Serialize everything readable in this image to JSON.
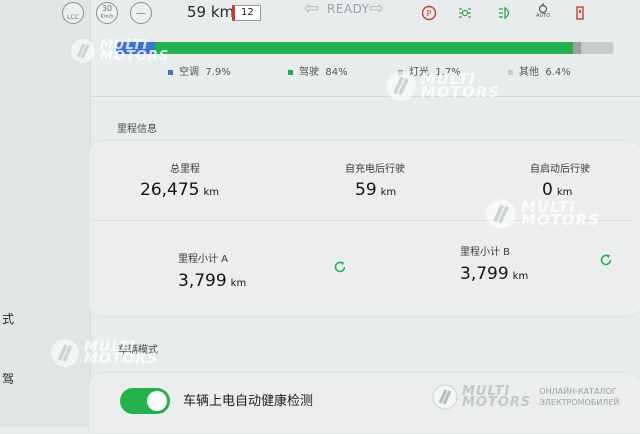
{
  "status_bar": {
    "lcc_label": "LCC",
    "speed_limit_label": "30",
    "speed_limit_unit": "Km/h",
    "minus_label": "—",
    "range_value": "59 km",
    "speed_limit_badge": "12",
    "gear_status": "READY",
    "indicator_colors": {
      "parking": "#d23a2a",
      "lights": "#2aa84a",
      "auto_light": "#2aa84a",
      "door": "#d23a2a"
    },
    "auto_label": "AUTO"
  },
  "energy": {
    "shares": [
      {
        "name": "空调",
        "value": "7.9%",
        "fraction": 0.079,
        "color": "#3a72d6"
      },
      {
        "name": "驾驶",
        "value": "84%",
        "fraction": 0.84,
        "color": "#22b24c"
      },
      {
        "name": "灯光",
        "value": "1.7%",
        "fraction": 0.017,
        "color": "#9a9fa2"
      },
      {
        "name": "其他",
        "value": "6.4%",
        "fraction": 0.064,
        "color": "#c8cbcc"
      }
    ]
  },
  "mileage": {
    "section_title": "里程信息",
    "total": {
      "label": "总里程",
      "value": "26,475",
      "unit": "km"
    },
    "since_charge": {
      "label": "自充电后行驶",
      "value": "59",
      "unit": "km"
    },
    "since_start": {
      "label": "自启动后行驶",
      "value": "0",
      "unit": "km"
    },
    "trip_a": {
      "label": "里程小计 A",
      "value": "3,799",
      "unit": "km"
    },
    "trip_b": {
      "label": "里程小计 B",
      "value": "3,799",
      "unit": "km"
    }
  },
  "vehicle_mode": {
    "section_title": "车辆模式",
    "health_check_label": "车辆上电自动健康检测",
    "health_check_on": true
  },
  "sidebar_fragments": {
    "item_1": "式",
    "item_2": "驾"
  },
  "watermark": {
    "line1": "MULTI",
    "line2": "MOTORS",
    "catalog_line1": "ОНЛАЙН-КАТАЛОГ",
    "catalog_line2": "ЭЛЕКТРОМОБИЛЕЙ"
  }
}
